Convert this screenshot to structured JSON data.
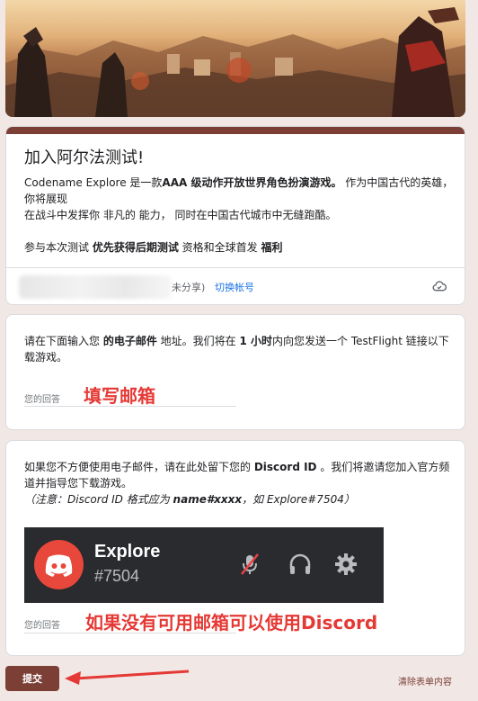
{
  "form": {
    "title": "加入阿尔法测试!",
    "desc_intro": "Codename Explore 是一款",
    "desc_bold1": "AAA 级动作开放世界角色扮演游戏。",
    "desc_mid": " 作为中国古代的英雄，你将展现",
    "desc_line2": "在战斗中发挥你 非凡的 能力， 同时在中国古代城市中无缝跑酷。",
    "desc_line3_a": "参与本次测试 ",
    "desc_line3_bold": "优先获得后期测试",
    "desc_line3_b": " 资格和全球首发 ",
    "desc_line3_bold2": "福利"
  },
  "account": {
    "not_shared": "未分享)",
    "switch_label": "切换帐号"
  },
  "q_email": {
    "text_a": "请在下面输入您 ",
    "text_bold1": "的电子邮件",
    "text_b": " 地址。我们将在 ",
    "text_bold2": "1 小时",
    "text_c": "内向您发送一个 TestFlight 链接以下载游戏。",
    "placeholder": "您的回答",
    "annotation": "填写邮箱"
  },
  "q_discord": {
    "text_a": "如果您不方便使用电子邮件，请在此处留下您的 ",
    "text_bold": "Discord ID",
    "text_b": " 。我们将邀请您加入官方频道并指导您下载游戏。",
    "note_a": "（注意：Discord ID 格式应为 ",
    "note_bold": "name#xxxx",
    "note_b": "，如 Explore#7504）",
    "discord_name": "Explore",
    "discord_tag": "#7504",
    "placeholder": "您的回答",
    "annotation": "如果没有可用邮箱可以使用Discord"
  },
  "footer": {
    "submit_label": "提交",
    "clear_label": "清除表单内容"
  },
  "colors": {
    "accent": "#7b3f36",
    "background": "#f1e7e4",
    "annotation_red": "#e53935",
    "link_blue": "#1a73e8",
    "discord_red": "#e8483b"
  }
}
